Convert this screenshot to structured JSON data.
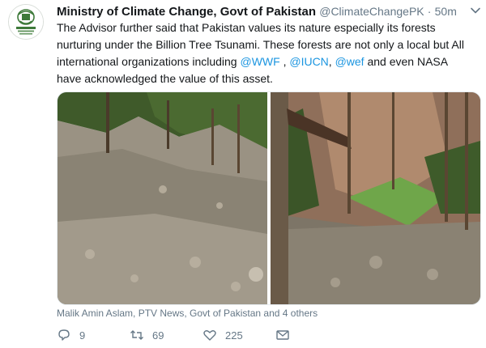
{
  "tweet": {
    "display_name": "Ministry of Climate Change, Govt of Pakistan",
    "handle": "@ClimateChangePK",
    "separator": "·",
    "time": "50m",
    "text_before_mentions": "The Advisor further said that Pakistan values its nature especially its forests nurturing under the Billion Tree Tsunami. These forests are not only a local but All international organizations including ",
    "mention_1": "@WWF",
    "sep_1": " , ",
    "mention_2": "@IUCN",
    "sep_2": ", ",
    "mention_3": "@wef",
    "text_after_mentions": " and even NASA have acknowledged the value of this asset.",
    "tagged_people": "Malik Amin Aslam, PTV News, Govt of Pakistan and 4 others",
    "reply_count": "9",
    "retweet_count": "69",
    "like_count": "225",
    "icons": {
      "avatar": "pakistan-government-emblem",
      "caret": "chevron-down-icon",
      "reply": "reply-icon",
      "retweet": "retweet-icon",
      "like": "heart-icon",
      "message": "message-envelope-icon"
    },
    "colors": {
      "link": "#1b95e0",
      "muted": "#657786",
      "text": "#14171a"
    }
  }
}
